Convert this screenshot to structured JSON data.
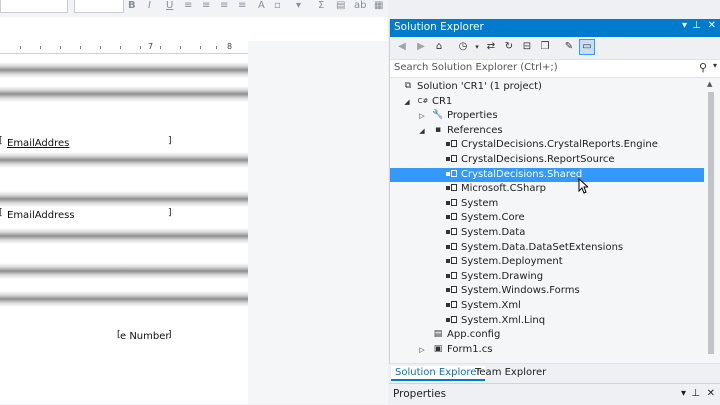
{
  "toolbar": {
    "icons": [
      "bold-icon",
      "italic-icon",
      "underline-icon",
      "strikethrough-icon",
      "align-left-icon",
      "align-center-icon",
      "align-right-icon",
      "justify-icon",
      "font-color-icon",
      "border-icon",
      "sum-icon",
      "insert-field-icon",
      "text-object-icon",
      "chart-icon",
      "picture-icon"
    ]
  },
  "designer": {
    "ruler": [
      "7",
      "8"
    ],
    "fields": [
      {
        "text": "EmailAddres"
      },
      {
        "text": "EmailAddress"
      },
      {
        "text": "e Number"
      }
    ]
  },
  "solution_explorer": {
    "title": "Solution Explorer",
    "search_placeholder": "Search Solution Explorer (Ctrl+;)",
    "toolbar_icons": [
      "back-icon",
      "forward-icon",
      "home-icon",
      "pending-changes-icon",
      "sync-icon",
      "refresh-icon",
      "collapse-all-icon",
      "show-all-files-icon",
      "properties-icon",
      "preview-icon"
    ],
    "tree": [
      {
        "label": "Solution 'CR1' (1 project)",
        "icon": "solution-icon",
        "level": 0,
        "arrow": ""
      },
      {
        "label": "CR1",
        "icon": "csharp-project-icon",
        "level": 1,
        "arrow": "expanded"
      },
      {
        "label": "Properties",
        "icon": "wrench-icon",
        "level": 2,
        "arrow": "collapsed"
      },
      {
        "label": "References",
        "icon": "references-icon",
        "level": 2,
        "arrow": "expanded"
      },
      {
        "label": "CrystalDecisions.CrystalReports.Engine",
        "icon": "reference-icon",
        "level": 3,
        "arrow": ""
      },
      {
        "label": "CrystalDecisions.ReportSource",
        "icon": "reference-icon",
        "level": 3,
        "arrow": ""
      },
      {
        "label": "CrystalDecisions.Shared",
        "icon": "reference-icon",
        "level": 3,
        "arrow": "",
        "selected": true
      },
      {
        "label": "Microsoft.CSharp",
        "icon": "reference-icon",
        "level": 3,
        "arrow": ""
      },
      {
        "label": "System",
        "icon": "reference-icon",
        "level": 3,
        "arrow": ""
      },
      {
        "label": "System.Core",
        "icon": "reference-icon",
        "level": 3,
        "arrow": ""
      },
      {
        "label": "System.Data",
        "icon": "reference-icon",
        "level": 3,
        "arrow": ""
      },
      {
        "label": "System.Data.DataSetExtensions",
        "icon": "reference-icon",
        "level": 3,
        "arrow": ""
      },
      {
        "label": "System.Deployment",
        "icon": "reference-icon",
        "level": 3,
        "arrow": ""
      },
      {
        "label": "System.Drawing",
        "icon": "reference-icon",
        "level": 3,
        "arrow": ""
      },
      {
        "label": "System.Windows.Forms",
        "icon": "reference-icon",
        "level": 3,
        "arrow": ""
      },
      {
        "label": "System.Xml",
        "icon": "reference-icon",
        "level": 3,
        "arrow": ""
      },
      {
        "label": "System.Xml.Linq",
        "icon": "reference-icon",
        "level": 3,
        "arrow": ""
      },
      {
        "label": "App.config",
        "icon": "config-file-icon",
        "level": 2,
        "arrow": ""
      },
      {
        "label": "Form1.cs",
        "icon": "form-icon",
        "level": 2,
        "arrow": "collapsed"
      }
    ],
    "tabs": [
      "Solution Explorer",
      "Team Explorer"
    ]
  },
  "properties": {
    "title": "Properties"
  },
  "colors": {
    "accent": "#007acc",
    "selection": "#3399ff"
  }
}
